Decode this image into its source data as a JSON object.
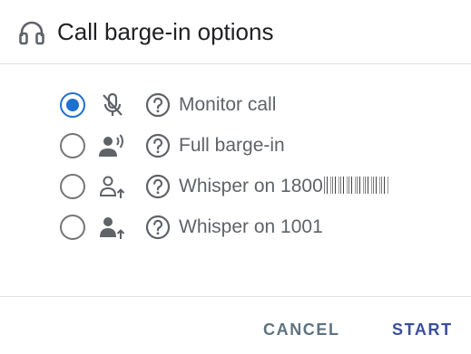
{
  "dialog": {
    "title": "Call barge-in options",
    "header_icon": "headset-icon"
  },
  "options": [
    {
      "label": "Monitor call",
      "icon": "mic-off-icon",
      "selected": true
    },
    {
      "label": "Full barge-in",
      "icon": "person-speaking-icon",
      "selected": false
    },
    {
      "label": "Whisper on 1800",
      "icon": "person-outline-arrow-up-icon",
      "selected": false,
      "redacted_suffix": true
    },
    {
      "label": "Whisper on 1001",
      "icon": "person-arrow-up-icon",
      "selected": false
    }
  ],
  "help_icon": "help-circle-icon",
  "actions": {
    "cancel_label": "CANCEL",
    "start_label": "START"
  },
  "colors": {
    "accent": "#1e6fd1",
    "start_text": "#3a4f9a",
    "cancel_text": "#5f7380",
    "icon_gray": "#5f6368"
  }
}
